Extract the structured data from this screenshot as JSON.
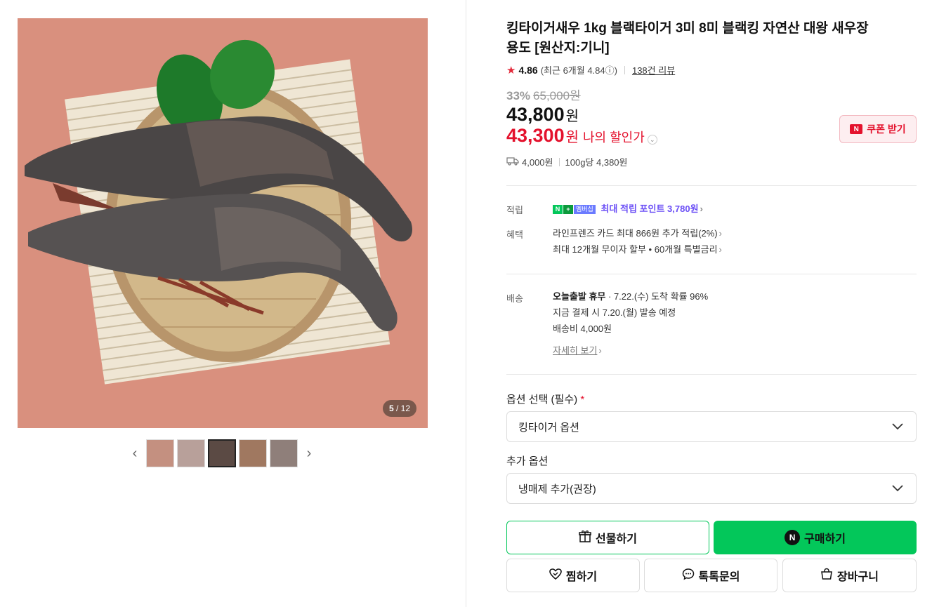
{
  "product": {
    "title": "킹타이거새우 1kg 블랙타이거 3미 8미 블랙킹 자연산 대왕 새우장용도 [원산지:기니]",
    "rating": "4.86",
    "rating_recent": "(최근 6개월 4.84ⓘ)",
    "reviews": "138건 리뷰",
    "discount_rate": "33%",
    "original_price": "65,000원",
    "price": "43,800",
    "won": "원",
    "my_price": "43,300",
    "my_price_label": "나의 할인가",
    "coupon_label": "쿠폰 받기",
    "coupon_icon": "N",
    "shipping_fee": "4,000원",
    "unit_price": "100g당 4,380원"
  },
  "gallery": {
    "counter_current": "5",
    "counter_total": "/ 12",
    "prev_icon": "‹",
    "next_icon": "›"
  },
  "benefits": {
    "point_label": "적립",
    "npay_n": "N",
    "npay_plus": "멤버십",
    "point_text": "최대 적립 포인트",
    "point_value": "3,780원",
    "benefit_label": "혜택",
    "card_text": "라인프렌즈 카드 최대 866원 추가 적립(2%)",
    "installment_text": "최대 12개월 무이자 할부 • 60개월 특별금리"
  },
  "delivery": {
    "label": "배송",
    "today": "오늘출발 휴무",
    "arrival": "· 7.22.(수) 도착 확률 96%",
    "dispatch": "지금 결제 시 7.20.(월) 발송 예정",
    "fee": "배송비 4,000원",
    "detail_link": "자세히 보기"
  },
  "options": {
    "required_label": "옵션 선택 (필수)",
    "required_mark": "*",
    "required_value": "킹타이거 옵션",
    "extra_label": "추가 옵션",
    "extra_value": "냉매제 추가(권장)"
  },
  "actions": {
    "gift": "선물하기",
    "buy": "구매하기",
    "buy_icon": "N",
    "wish": "찜하기",
    "talk": "톡톡문의",
    "cart": "장바구니"
  },
  "colors": {
    "accent_green": "#03c75a",
    "sale_red": "#e4122d",
    "point_purple": "#6b4ff6"
  }
}
